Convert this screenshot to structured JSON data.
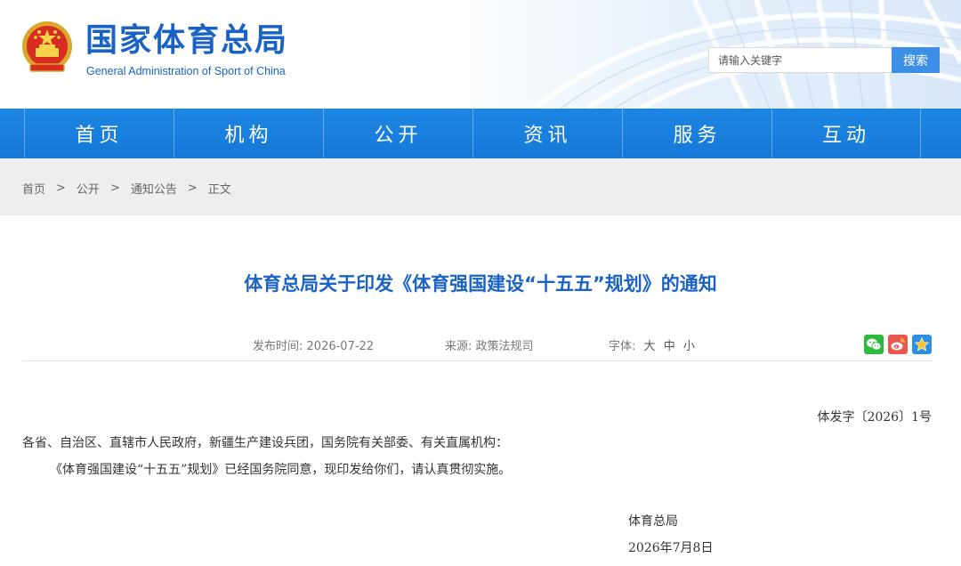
{
  "header": {
    "title": "国家体育总局",
    "subtitle": "General Administration of Sport of China"
  },
  "search": {
    "placeholder": "请输入关键字",
    "button_label": "搜索"
  },
  "nav": {
    "items": [
      {
        "label": "首页"
      },
      {
        "label": "机构"
      },
      {
        "label": "公开"
      },
      {
        "label": "资讯"
      },
      {
        "label": "服务"
      },
      {
        "label": "互动"
      }
    ]
  },
  "breadcrumb": {
    "items": [
      "首页",
      "公开",
      "通知公告",
      "正文"
    ],
    "separator": ">"
  },
  "article": {
    "title": "体育总局关于印发《体育强国建设“十五五”规划》的通知",
    "meta": {
      "date_label": "发布时间:",
      "date": "2026-07-22",
      "source_label": "来源:",
      "source": "政策法规司",
      "font_label": "字体:",
      "font_sizes": [
        "大",
        "中",
        "小"
      ]
    },
    "doc_number": "体发字〔2026〕1号",
    "salutation": "各省、自治区、直辖市人民政府，新疆生产建设兵团，国务院有关部委、有关直属机构：",
    "body": "《体育强国建设“十五五”规划》已经国务院同意，现印发给你们，请认真贯彻实施。",
    "signature": "体育总局",
    "sign_date": "2026年7月8日"
  },
  "share": {
    "icons": [
      "wechat-icon",
      "weibo-icon",
      "favorite-star-icon"
    ]
  },
  "colors": {
    "brand_blue": "#1a63c4",
    "nav_blue": "#1d86e3",
    "search_button": "#3d8ee6",
    "breadcrumb_bg": "#eeeeee",
    "wechat_green": "#2dbb3b",
    "weibo_red": "#e8584f",
    "star_blue": "#2c8fe0"
  }
}
